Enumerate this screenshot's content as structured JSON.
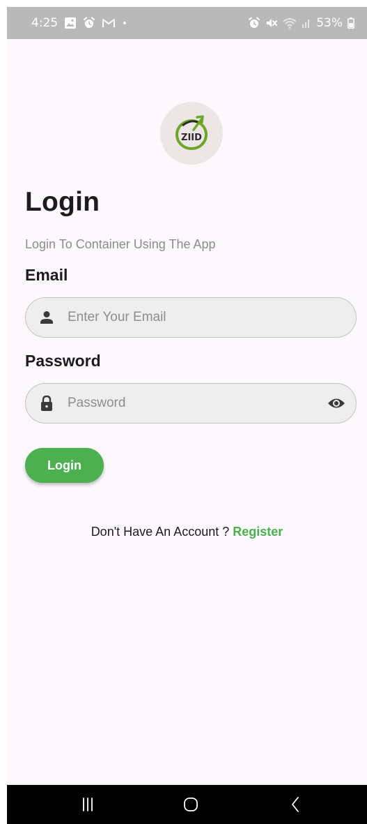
{
  "status_bar": {
    "time": "4:25",
    "battery": "53%",
    "icons": [
      "gallery-icon",
      "alarm-icon",
      "gmail-icon",
      "notification-dot",
      "alarm-icon",
      "mute-icon",
      "wifi-icon",
      "signal-icon",
      "battery-icon"
    ]
  },
  "logo": {
    "text": "ZIID",
    "colors": {
      "green": "#6ea62a",
      "dark": "#2b2b2b",
      "background": "#ece7e6"
    }
  },
  "screen": {
    "title": "Login",
    "subtitle": "Login To Container Using The App"
  },
  "form": {
    "email_label": "Email",
    "email_placeholder": "Enter Your Email",
    "email_value": "",
    "email_icon": "person-icon",
    "password_label": "Password",
    "password_placeholder": "Password",
    "password_value": "",
    "password_icon": "lock-icon",
    "password_toggle_icon": "eye-icon",
    "login_button": "Login"
  },
  "register": {
    "prompt": "Don't Have An Account ?",
    "link": "Register"
  },
  "nav_bar": {
    "icons": [
      "recent-apps-icon",
      "home-icon",
      "back-icon"
    ]
  },
  "colors": {
    "accent": "#4caf50",
    "background": "#fcf8fc",
    "field_background": "#efeeef",
    "text": "#1c1b1f",
    "muted_text": "#8d8b8f"
  }
}
